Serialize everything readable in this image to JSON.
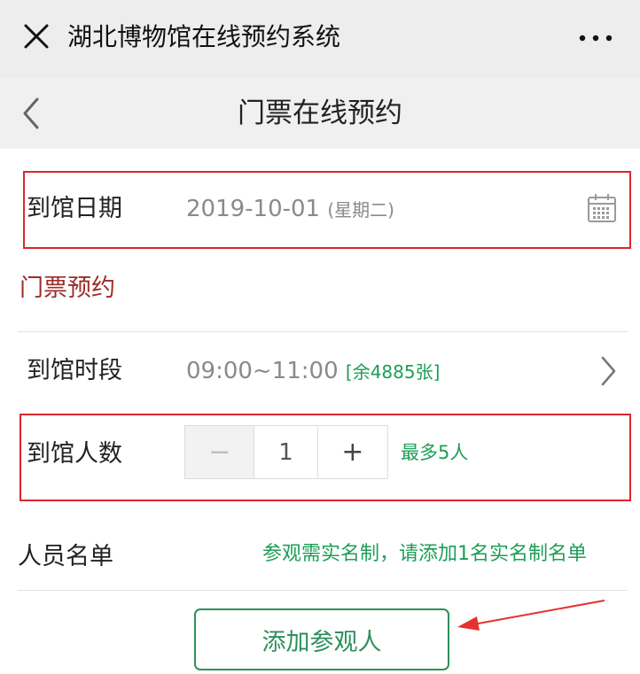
{
  "window": {
    "title": "湖北博物馆在线预约系统",
    "close_icon": "close-icon",
    "more_icon": "more-dots-icon"
  },
  "nav": {
    "title": "门票在线预约",
    "back_icon": "chevron-left-icon"
  },
  "visit_date": {
    "label": "到馆日期",
    "value": "2019-10-01",
    "weekday": "(星期二)",
    "icon": "calendar-icon"
  },
  "ticket_section": {
    "title": "门票预约"
  },
  "time_slot": {
    "label": "到馆时段",
    "value": "09:00~11:00",
    "remaining": "[余4885张]",
    "icon": "chevron-right-icon"
  },
  "visitor_count": {
    "label": "到馆人数",
    "minus": "−",
    "value": "1",
    "plus": "+",
    "max_note": "最多5人"
  },
  "visitor_list": {
    "label": "人员名单",
    "note": "参观需实名制，请添加1名实名制名单"
  },
  "add_visitor": {
    "label": "添加参观人"
  },
  "colors": {
    "highlight_box": "#d9272e",
    "accent_green": "#1d9e55",
    "section_red": "#9b2d2a",
    "arrow": "#e5322d"
  }
}
